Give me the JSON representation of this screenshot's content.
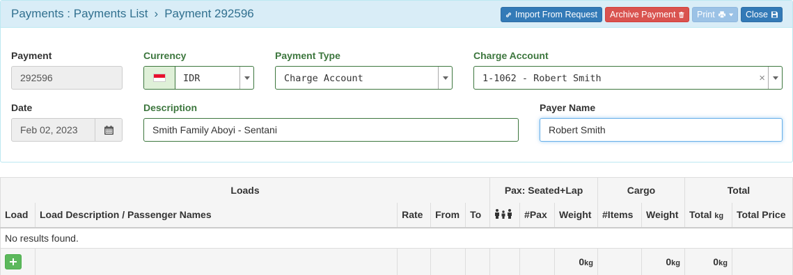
{
  "breadcrumb": {
    "root": "Payments : Payments List",
    "separator": "›",
    "current": "Payment 292596"
  },
  "toolbar": {
    "import_label": "Import From Request",
    "archive_label": "Archive Payment",
    "print_label": "Print",
    "close_label": "Close"
  },
  "form": {
    "payment": {
      "label": "Payment",
      "value": "292596"
    },
    "currency": {
      "label": "Currency",
      "value": "IDR",
      "flag": "indonesia-flag"
    },
    "payment_type": {
      "label": "Payment Type",
      "value": "Charge Account"
    },
    "charge_account": {
      "label": "Charge Account",
      "value": "1-1062 - Robert Smith",
      "clear": "×"
    },
    "date": {
      "label": "Date",
      "value": "Feb 02, 2023"
    },
    "description": {
      "label": "Description",
      "value": "Smith Family Aboyi - Sentani"
    },
    "payer_name": {
      "label": "Payer Name",
      "value": "Robert Smith"
    }
  },
  "table": {
    "group_headers": {
      "loads": "Loads",
      "pax": "Pax: Seated+Lap",
      "cargo": "Cargo",
      "total": "Total"
    },
    "columns": {
      "load": "Load",
      "description": "Load Description / Passenger Names",
      "rate": "Rate",
      "from": "From",
      "to": "To",
      "pax_count": "#Pax",
      "pax_weight": "Weight",
      "items": "#Items",
      "cargo_weight": "Weight",
      "total": "Total",
      "total_unit": "kg",
      "total_price": "Total Price"
    },
    "empty_message": "No results found.",
    "footer": {
      "pax_weight": "0",
      "pax_weight_unit": "kg",
      "cargo_weight": "0",
      "cargo_weight_unit": "kg",
      "total_weight": "0",
      "total_weight_unit": "kg"
    }
  },
  "colors": {
    "header_bg": "#d9edf7",
    "primary": "#337ab7",
    "danger": "#d9534f",
    "success": "#5cb85c",
    "label_green": "#3c763d"
  }
}
